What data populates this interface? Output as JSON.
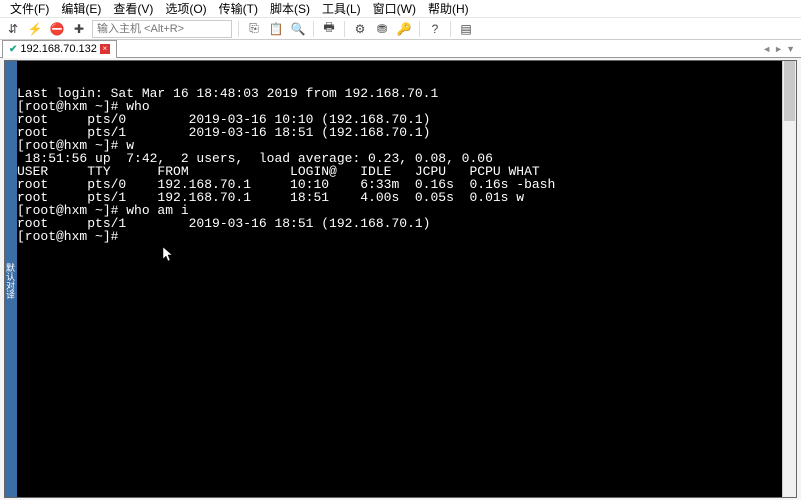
{
  "menu": {
    "file": "文件(F)",
    "edit": "编辑(E)",
    "view": "查看(V)",
    "options": "选项(O)",
    "transfer": "传输(T)",
    "script": "脚本(S)",
    "tools": "工具(L)",
    "window": "窗口(W)",
    "help": "帮助(H)"
  },
  "toolbar": {
    "host_placeholder": "输入主机 <Alt+R>"
  },
  "tab": {
    "title": "192.168.70.132",
    "close": "×"
  },
  "left_gutter": "默认对译",
  "terminal_lines": [
    "Last login: Sat Mar 16 18:48:03 2019 from 192.168.70.1",
    "[root@hxm ~]# who",
    "root     pts/0        2019-03-16 10:10 (192.168.70.1)",
    "root     pts/1        2019-03-16 18:51 (192.168.70.1)",
    "[root@hxm ~]# w",
    " 18:51:56 up  7:42,  2 users,  load average: 0.23, 0.08, 0.06",
    "USER     TTY      FROM             LOGIN@   IDLE   JCPU   PCPU WHAT",
    "root     pts/0    192.168.70.1     10:10    6:33m  0.16s  0.16s -bash",
    "root     pts/1    192.168.70.1     18:51    4.00s  0.05s  0.01s w",
    "[root@hxm ~]# who am i",
    "root     pts/1        2019-03-16 18:51 (192.168.70.1)",
    "[root@hxm ~]# "
  ],
  "icons": {
    "copy": "⎘",
    "paste": "📋",
    "find": "🔍",
    "print": "🖶",
    "gear": "⚙",
    "funnel": "⛃",
    "key": "🔑",
    "help": "?",
    "palette": "▤",
    "reconnect": "⇵",
    "bolt": "⚡",
    "stop": "⛔",
    "plus": "✚"
  },
  "nav": {
    "left": "◄",
    "right": "►",
    "down": "▼"
  }
}
